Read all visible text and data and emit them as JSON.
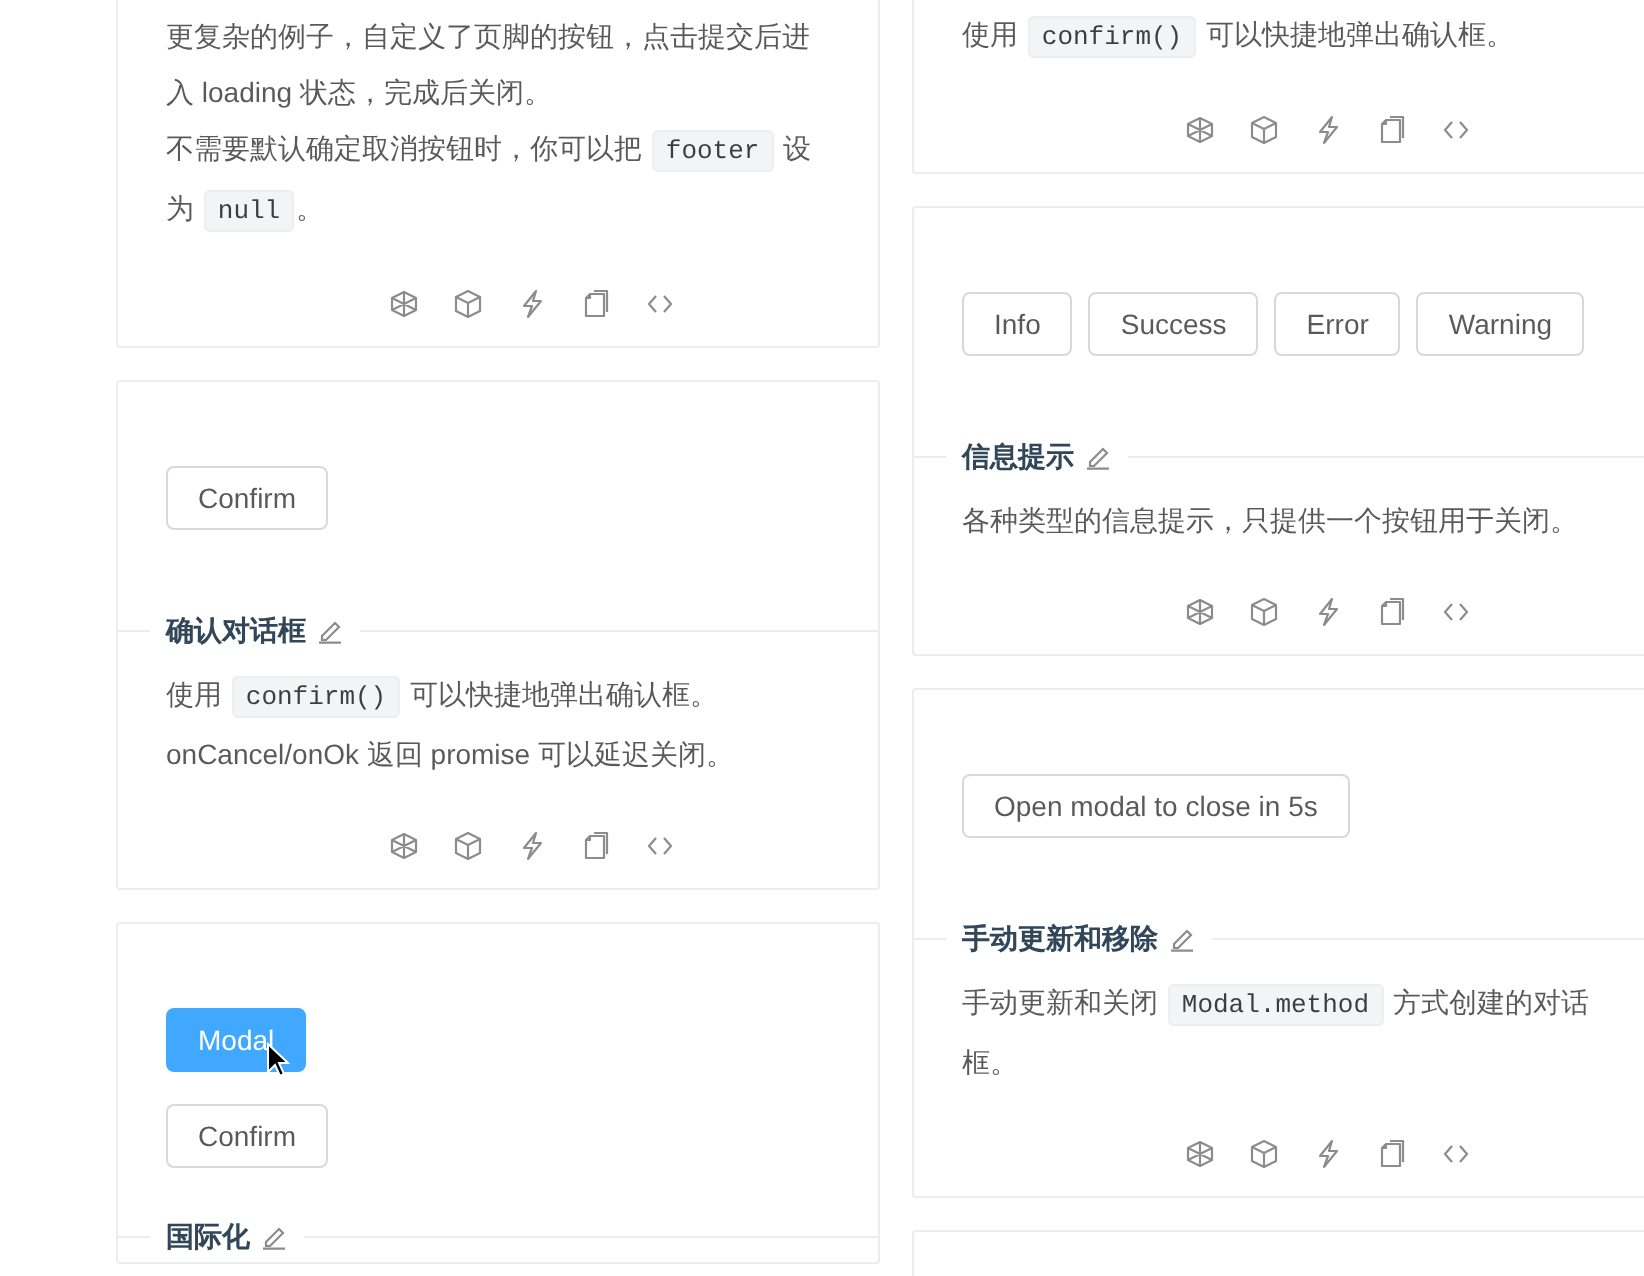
{
  "columns": [
    {
      "cards": [
        {
          "kind": "continued",
          "description": [
            [
              {
                "text": "更复杂的例子，自定义了页脚的按钮，点击提交后进入 loading 状态，完成后关闭。",
                "kind": "text"
              }
            ],
            [
              {
                "text": "不需要默认确定取消按钮时，你可以把 ",
                "kind": "text"
              },
              {
                "text": "footer",
                "kind": "code"
              },
              {
                "text": " 设为 ",
                "kind": "text"
              },
              {
                "text": "null",
                "kind": "code"
              },
              {
                "text": "。",
                "kind": "text"
              }
            ]
          ]
        },
        {
          "kind": "row",
          "buttons": [
            {
              "label": "Confirm",
              "kind": "default",
              "hovered": false
            }
          ],
          "title": "确认对话框",
          "description": [
            [
              {
                "text": "使用 ",
                "kind": "text"
              },
              {
                "text": "confirm()",
                "kind": "code"
              },
              {
                "text": " 可以快捷地弹出确认框。",
                "kind": "text"
              }
            ],
            [
              {
                "text": "onCancel/onOk 返回 promise 可以延迟关闭。",
                "kind": "text"
              }
            ]
          ]
        },
        {
          "kind": "stack",
          "buttons": [
            {
              "label": "Modal",
              "kind": "primary",
              "hovered": true
            },
            {
              "label": "Confirm",
              "kind": "default",
              "hovered": false
            }
          ],
          "title": "国际化"
        }
      ]
    },
    {
      "cards": [
        {
          "kind": "continued",
          "description": [
            [
              {
                "text": "使用 ",
                "kind": "text"
              },
              {
                "text": "confirm()",
                "kind": "code"
              },
              {
                "text": " 可以快捷地弹出确认框。",
                "kind": "text"
              }
            ]
          ]
        },
        {
          "kind": "row",
          "buttons": [
            {
              "label": "Info",
              "kind": "default",
              "hovered": false
            },
            {
              "label": "Success",
              "kind": "default",
              "hovered": false
            },
            {
              "label": "Error",
              "kind": "default",
              "hovered": false
            },
            {
              "label": "Warning",
              "kind": "default",
              "hovered": false
            }
          ],
          "title": "信息提示",
          "description": [
            [
              {
                "text": "各种类型的信息提示，只提供一个按钮用于关闭。",
                "kind": "text"
              }
            ]
          ]
        },
        {
          "kind": "row",
          "buttons": [
            {
              "label": "Open modal to close in 5s",
              "kind": "default",
              "hovered": false
            }
          ],
          "title": "手动更新和移除",
          "description": [
            [
              {
                "text": "手动更新和关闭 ",
                "kind": "text"
              },
              {
                "text": "Modal.method",
                "kind": "code"
              },
              {
                "text": " 方式创建的对话框。",
                "kind": "text"
              }
            ]
          ]
        },
        {
          "kind": "blank"
        }
      ]
    }
  ]
}
